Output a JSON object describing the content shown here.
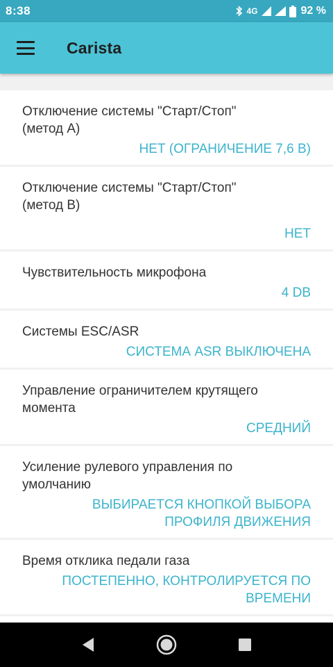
{
  "status_bar": {
    "time": "8:38",
    "network": "4G",
    "battery": "92 %"
  },
  "app_bar": {
    "title": "Carista",
    "menu_icon": "hamburger-menu-icon"
  },
  "colors": {
    "status_bar": "#37a8bf",
    "app_bar": "#4dc3d7",
    "value_text": "#3cb4cc",
    "title_text": "#333333"
  },
  "settings": [
    {
      "title": "Отключение системы \"Старт/Стоп\" (метод A)",
      "value_lines": [
        "НЕТ (ОГРАНИЧЕНИЕ 7,6 В)"
      ]
    },
    {
      "title": "Отключение системы \"Старт/Стоп\" (метод B)",
      "value_lines": [
        "НЕТ"
      ]
    },
    {
      "title": "Чувствительность микрофона",
      "value_lines": [
        "4 DB"
      ]
    },
    {
      "title": "Системы ESC/ASR",
      "value_lines": [
        "СИСТЕМА ASR ВЫКЛЮЧЕНА"
      ]
    },
    {
      "title": "Управление ограничителем крутящего момента",
      "value_lines": [
        "СРЕДНИЙ"
      ]
    },
    {
      "title": "Усиление рулевого управления по умолчанию",
      "value_lines": [
        "ВЫБИРАЕТСЯ КНОПКОЙ ВЫБОРА",
        "ПРОФИЛЯ ДВИЖЕНИЯ"
      ]
    },
    {
      "title": "Время отклика педали газа",
      "value_lines": [
        "ПОСТЕПЕННО, КОНТРОЛИРУЕТСЯ ПО",
        "ВРЕМЕНИ"
      ]
    }
  ],
  "nav_bar": {
    "back_icon": "back-triangle-icon",
    "home_icon": "home-circle-icon",
    "recents_icon": "recents-square-icon"
  }
}
